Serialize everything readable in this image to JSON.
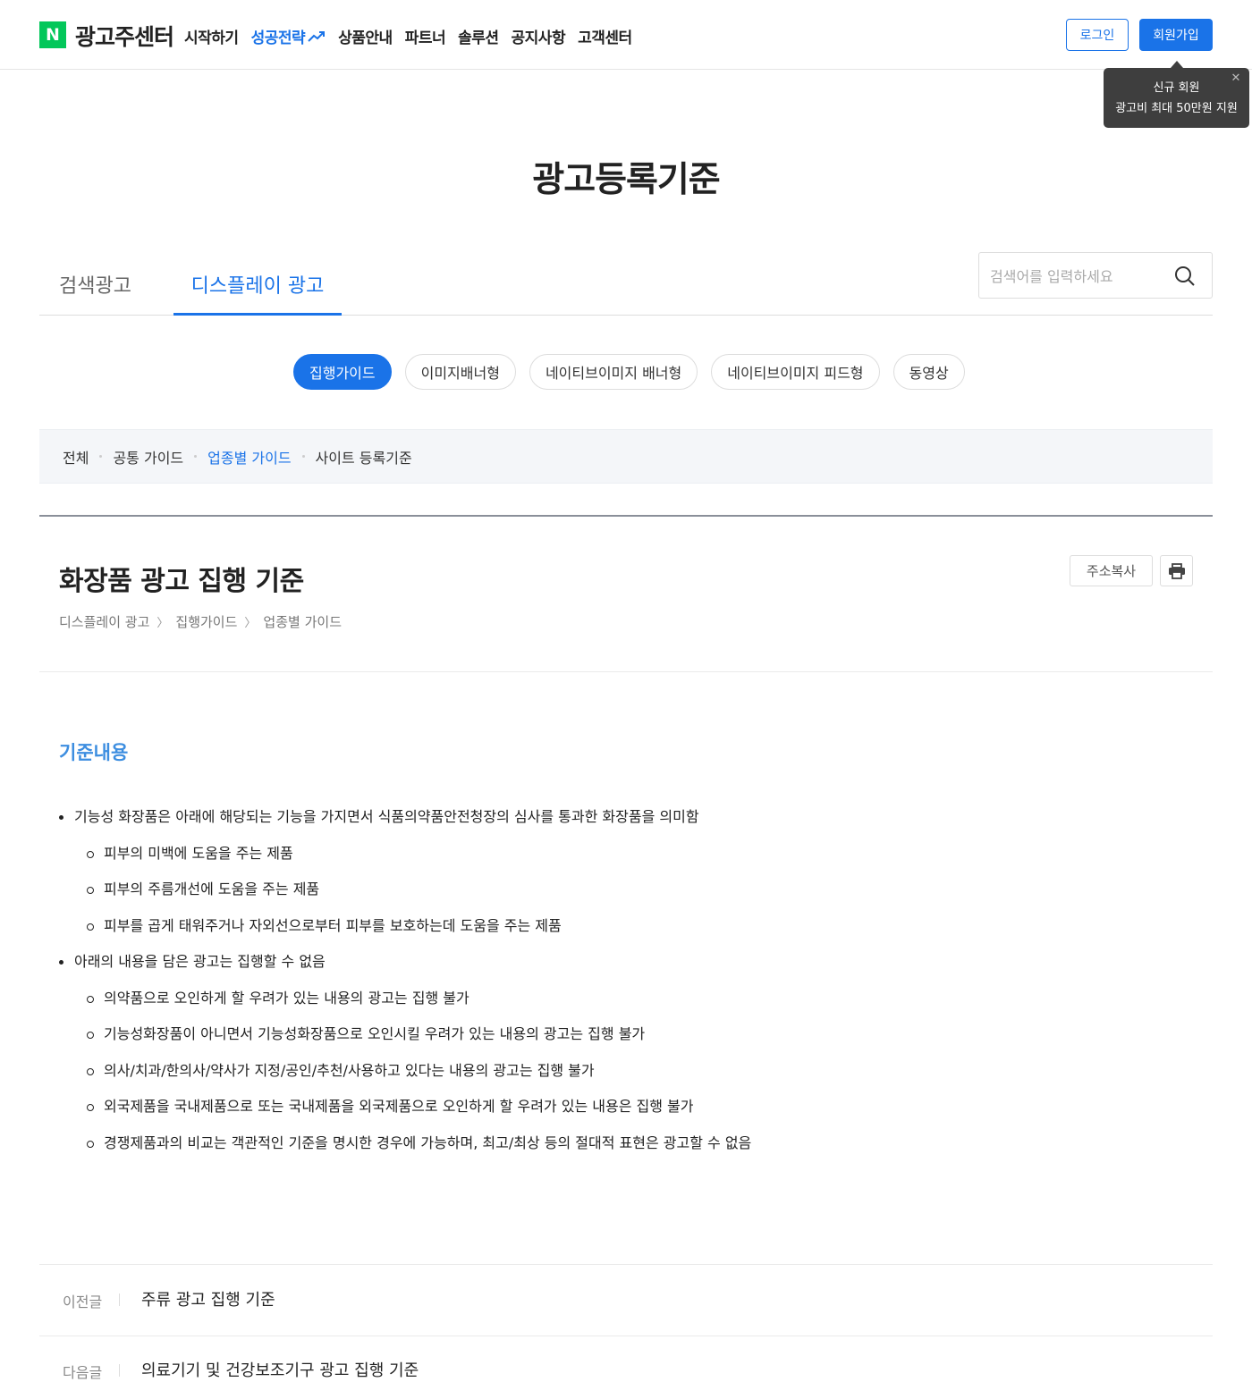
{
  "header": {
    "logo_letter": "N",
    "logo_text": "광고주센터",
    "nav": [
      "시작하기",
      "성공전략",
      "상품안내",
      "파트너",
      "솔루션",
      "공지사항",
      "고객센터"
    ],
    "login_label": "로그인",
    "join_label": "회원가입",
    "tooltip_line1": "신규 회원",
    "tooltip_line2": "광고비 최대 50만원 지원"
  },
  "page_title": "광고등록기준",
  "tabs": [
    "검색광고",
    "디스플레이 광고"
  ],
  "search": {
    "placeholder": "검색어를 입력하세요"
  },
  "pills": [
    "집행가이드",
    "이미지배너형",
    "네이티브이미지 배너형",
    "네이티브이미지 피드형",
    "동영상"
  ],
  "filters": [
    "전체",
    "공통 가이드",
    "업종별 가이드",
    "사이트 등록기준"
  ],
  "article": {
    "title": "화장품 광고 집행 기준",
    "breadcrumb": [
      "디스플레이 광고",
      "집행가이드",
      "업종별 가이드"
    ],
    "copy_label": "주소복사",
    "section_heading": "기준내용",
    "items": [
      "기능성 화장품은 아래에 해당되는 기능을 가지면서 식품의약품안전청장의 심사를 통과한 화장품을 의미함",
      "피부의 미백에 도움을 주는 제품",
      "피부의 주름개선에 도움을 주는 제품",
      "피부를 곱게 태워주거나 자외선으로부터 피부를 보호하는데 도움을 주는 제품",
      "아래의 내용을 담은 광고는 집행할 수 없음",
      "의약품으로 오인하게 할 우려가 있는 내용의 광고는 집행 불가",
      "기능성화장품이 아니면서 기능성화장품으로 오인시킬 우려가 있는 내용의 광고는 집행 불가",
      "의사/치과/한의사/약사가 지정/공인/추천/사용하고 있다는 내용의 광고는 집행 불가",
      "외국제품을 국내제품으로 또는 국내제품을 외국제품으로 오인하게 할 우려가 있는 내용은 집행 불가",
      "경쟁제품과의 비교는 객관적인 기준을 명시한 경우에 가능하며, 최고/최상 등의 절대적 표현은 광고할 수 없음"
    ]
  },
  "prev": {
    "label": "이전글",
    "title": "주류 광고 집행 기준"
  },
  "next": {
    "label": "다음글",
    "title": "의료기기 및 건강보조기구 광고 집행 기준"
  },
  "colors": {
    "accent": "#1a73e8",
    "naver_green": "#03c75a",
    "section_heading": "#3d8ee0"
  },
  "icons": [
    "trend-arrow-icon",
    "close-icon",
    "search-icon",
    "chevron-right-icon",
    "print-icon"
  ]
}
